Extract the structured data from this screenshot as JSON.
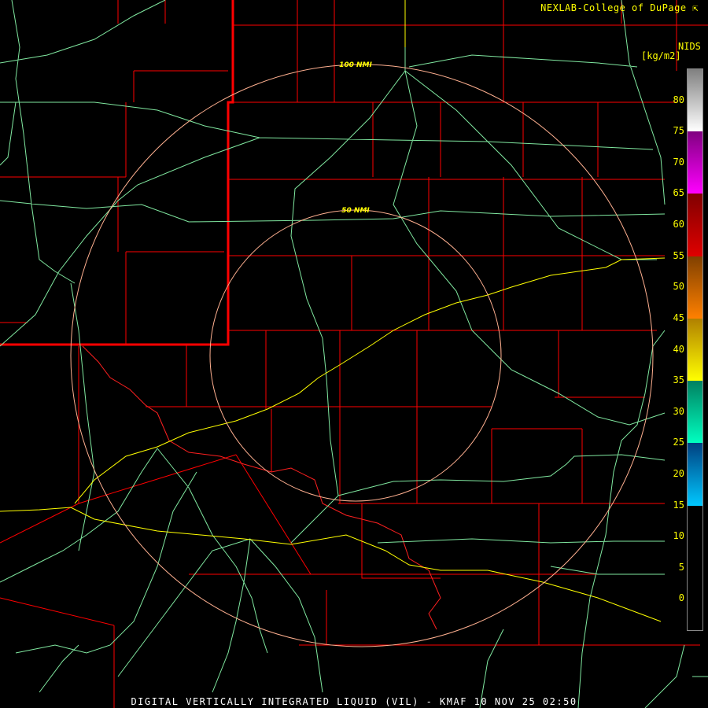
{
  "header": {
    "credit": "NEXLAB-College of DuPage ⇱",
    "product_source": "NIDS",
    "units": "[kg/m2]"
  },
  "caption": "DIGITAL VERTICALLY INTEGRATED LIQUID (VIL) - KMAF 10 NOV 25 02:50",
  "range_rings": [
    {
      "label": "100 NMI"
    },
    {
      "label": "50 NMI"
    }
  ],
  "colors": {
    "county": "#ff0000",
    "state": "#ff0000",
    "roads": "#80e8a0",
    "river": "#ffff00",
    "rings": "#ffb090",
    "text": "#ffff00"
  },
  "colorbar": {
    "ticks": [
      "80",
      "75",
      "70",
      "65",
      "60",
      "55",
      "50",
      "45",
      "40",
      "35",
      "30",
      "25",
      "20",
      "15",
      "10",
      "5",
      "0"
    ],
    "segments": [
      {
        "from": 75,
        "to": 85,
        "colors": [
          "#808080",
          "#ffffff"
        ]
      },
      {
        "from": 65,
        "to": 75,
        "colors": [
          "#800080",
          "#ff00ff"
        ]
      },
      {
        "from": 55,
        "to": 65,
        "colors": [
          "#800000",
          "#e00000"
        ]
      },
      {
        "from": 45,
        "to": 55,
        "colors": [
          "#804000",
          "#ff8000"
        ]
      },
      {
        "from": 35,
        "to": 45,
        "colors": [
          "#b08000",
          "#ffff00"
        ]
      },
      {
        "from": 25,
        "to": 35,
        "colors": [
          "#008060",
          "#00ffc0"
        ]
      },
      {
        "from": 15,
        "to": 25,
        "colors": [
          "#004080",
          "#00c8ff"
        ]
      }
    ]
  }
}
